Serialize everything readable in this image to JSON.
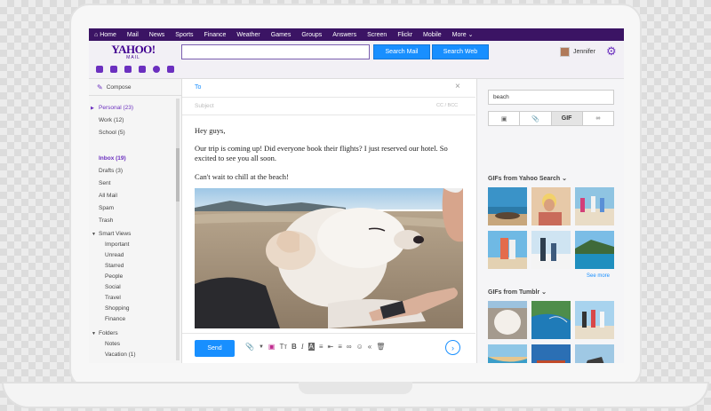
{
  "topnav": {
    "items": [
      "Home",
      "Mail",
      "News",
      "Sports",
      "Finance",
      "Weather",
      "Games",
      "Groups",
      "Answers",
      "Screen",
      "Flickr",
      "Mobile",
      "More"
    ]
  },
  "header": {
    "logo_line1": "YAHOO!",
    "logo_line2": "MAIL",
    "search_value": "",
    "search_mail_label": "Search Mail",
    "search_web_label": "Search Web",
    "user_name": "Jennifer"
  },
  "sidebar": {
    "compose_label": "Compose",
    "personal": "Personal (23)",
    "work": "Work (12)",
    "school": "School (5)",
    "inbox": "Inbox (19)",
    "drafts": "Drafts (3)",
    "sent": "Sent",
    "all_mail": "All Mail",
    "spam": "Spam",
    "trash": "Trash",
    "smart_views": "Smart Views",
    "smart": [
      "Important",
      "Unread",
      "Starred",
      "People",
      "Social",
      "Travel",
      "Shopping",
      "Finance"
    ],
    "folders": "Folders",
    "folder_items": [
      "Notes",
      "Vacation (1)"
    ]
  },
  "compose": {
    "to_label": "To",
    "subject_placeholder": "Subject",
    "cc_label": "CC / BCC",
    "greeting": "Hey guys,",
    "paragraph1": "Our trip is coming up! Did everyone book their flights? I just reserved our hotel. So excited to see you all soon.",
    "paragraph2": "Can't wait to chill at the beach!",
    "send_label": "Send"
  },
  "right": {
    "search_value": "beach",
    "tabs": [
      "▣",
      "⌘",
      "GIF",
      "∞"
    ],
    "active_tab": "GIF",
    "gif_section": "GIFs from Yahoo Search",
    "tumblr_section": "GIFs from Tumblr",
    "see_more": "See more"
  },
  "colors": {
    "brand_purple": "#400090",
    "nav_purple": "#3b1464",
    "accent_blue": "#188fff"
  }
}
